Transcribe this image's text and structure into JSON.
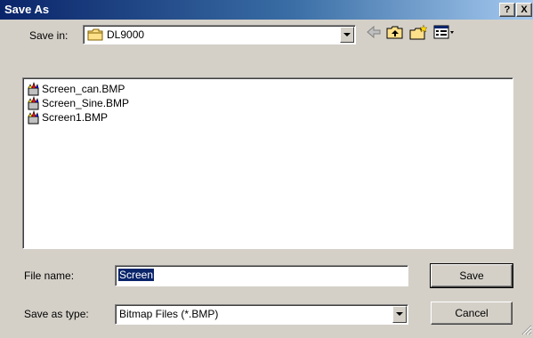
{
  "window": {
    "title": "Save As",
    "help_label": "?",
    "close_label": "X"
  },
  "save_in": {
    "label": "Save in:",
    "value": "DL9000"
  },
  "toolbar": {
    "back_icon": "back-arrow-icon",
    "up_icon": "up-one-level-icon",
    "new_folder_icon": "new-folder-icon",
    "view_menu_icon": "view-menu-icon"
  },
  "files": [
    {
      "name": "Screen_can.BMP",
      "icon": "bitmap-file-icon"
    },
    {
      "name": "Screen_Sine.BMP",
      "icon": "bitmap-file-icon"
    },
    {
      "name": "Screen1.BMP",
      "icon": "bitmap-file-icon"
    }
  ],
  "file_name": {
    "label": "File name:",
    "value": "Screen"
  },
  "save_as_type": {
    "label": "Save as type:",
    "value": "Bitmap Files (*.BMP)"
  },
  "buttons": {
    "save": "Save",
    "cancel": "Cancel"
  },
  "colors": {
    "titlebar_start": "#0a246a",
    "titlebar_end": "#a6caf0",
    "face": "#d4d0c8",
    "selection": "#0a246a"
  }
}
